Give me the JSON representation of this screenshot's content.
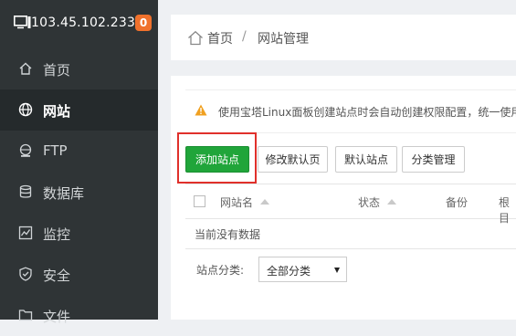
{
  "server": {
    "ip": "103.45.102.233",
    "badge_count": "0"
  },
  "sidebar": {
    "items": [
      {
        "label": "首页",
        "icon": "home-icon"
      },
      {
        "label": "网站",
        "icon": "globe-icon",
        "active": true
      },
      {
        "label": "FTP",
        "icon": "ftp-icon"
      },
      {
        "label": "数据库",
        "icon": "database-icon"
      },
      {
        "label": "监控",
        "icon": "monitor-chart-icon"
      },
      {
        "label": "安全",
        "icon": "shield-icon"
      },
      {
        "label": "文件",
        "icon": "folder-icon"
      }
    ]
  },
  "breadcrumb": {
    "home": "首页",
    "separator": "/",
    "current": "网站管理"
  },
  "notice": {
    "text": "使用宝塔Linux面板创建站点时会自动创建权限配置，统一使用"
  },
  "toolbar": {
    "add_site": "添加站点",
    "edit_default_page": "修改默认页",
    "default_site": "默认站点",
    "category_manage": "分类管理"
  },
  "table": {
    "columns": [
      "网站名",
      "状态",
      "备份",
      "根目"
    ],
    "empty_text": "当前没有数据"
  },
  "filter": {
    "label": "站点分类:",
    "selected": "全部分类"
  },
  "colors": {
    "accent": "#20a53a",
    "sidebar_bg": "#2f3436",
    "badge": "#f0712c",
    "highlight": "#e0302b"
  }
}
